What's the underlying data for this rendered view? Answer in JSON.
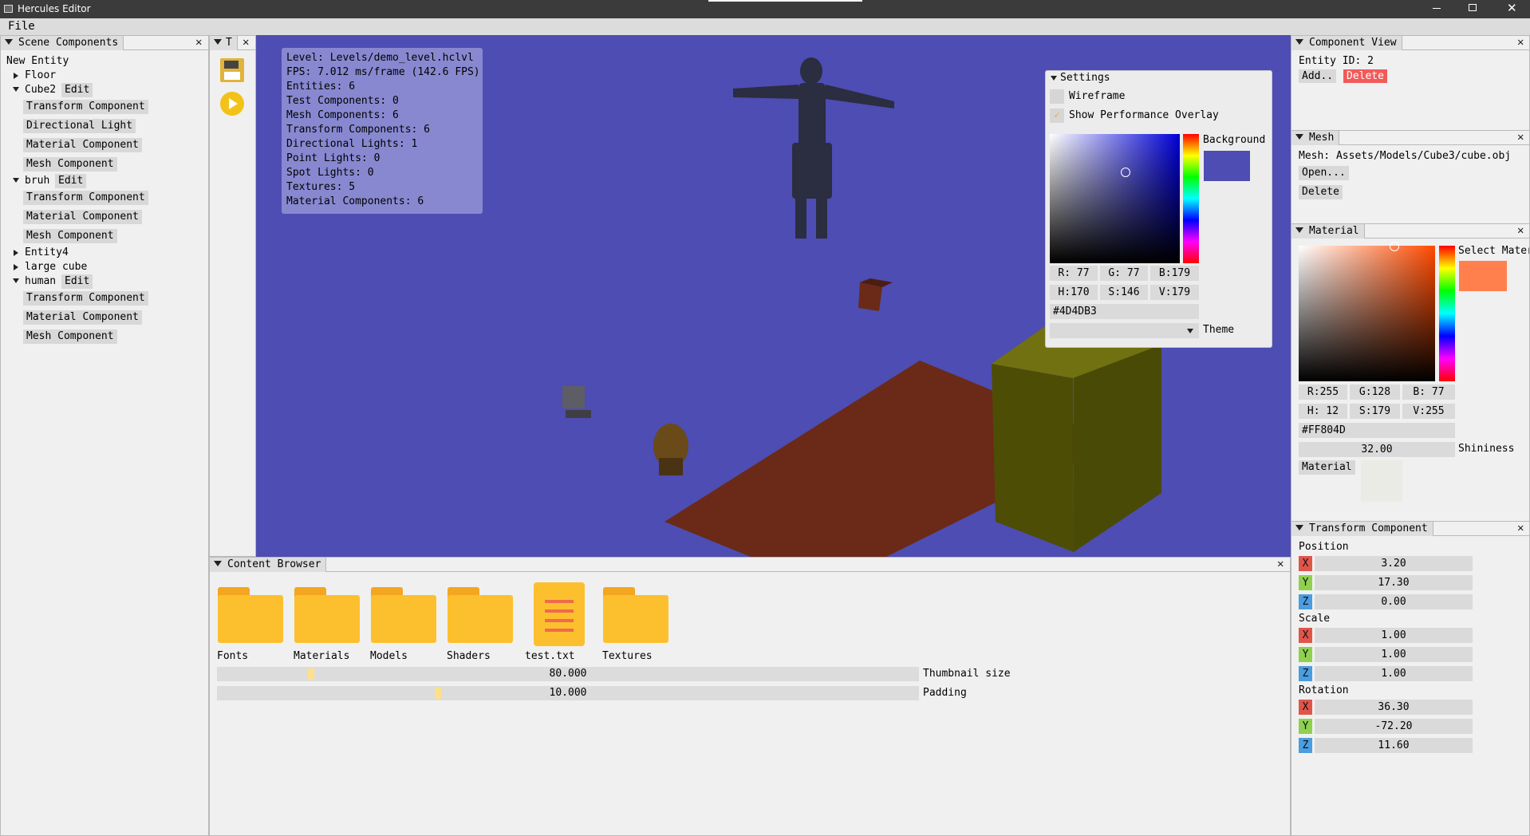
{
  "window": {
    "title": "Hercules Editor",
    "icon": "app-icon"
  },
  "menu": {
    "file": "File"
  },
  "scene": {
    "tab": "Scene Components",
    "new_entity": "New Entity",
    "floor": "Floor",
    "cube2": "Cube2",
    "bruh": "bruh",
    "entity4": "Entity4",
    "large_cube": "large cube",
    "human": "human",
    "edit": "Edit",
    "transform": "Transform Component",
    "dir_light": "Directional Light",
    "material": "Material Component",
    "mesh": "Mesh Component"
  },
  "toolbar": {
    "tab": "T",
    "save_icon": "save-icon",
    "play_icon": "play-icon"
  },
  "overlay": {
    "level": "Level: Levels/demo_level.hclvl",
    "fps": "FPS: 7.012 ms/frame (142.6 FPS)",
    "entities": "Entities: 6",
    "test": "Test Components: 0",
    "mesh": "Mesh Components: 6",
    "transform": "Transform Components: 6",
    "dirlights": "Directional Lights: 1",
    "pointlights": "Point Lights: 0",
    "spotlights": "Spot Lights: 0",
    "textures": "Textures: 5",
    "materials": "Material Components: 6"
  },
  "settings": {
    "title": "Settings",
    "wireframe": "Wireframe",
    "overlay": "Show Performance Overlay",
    "overlay_checked": true,
    "background_label": "Background",
    "background_color": "#4D4DB3",
    "r": "R: 77",
    "g": "G: 77",
    "b": "B:179",
    "h": "H:170",
    "s": "S:146",
    "v": "V:179",
    "hex": "#4D4DB3",
    "theme": "Theme"
  },
  "component_view": {
    "tab": "Component View",
    "entity_id": "Entity ID: 2",
    "add": "Add..",
    "delete": "Delete"
  },
  "mesh": {
    "tab": "Mesh",
    "path": "Mesh: Assets/Models/Cube3/cube.obj",
    "open": "Open...",
    "delete": "Delete"
  },
  "material": {
    "tab": "Material",
    "select": "Select Material",
    "color": "#FF804D",
    "r": "R:255",
    "g": "G:128",
    "b": "B: 77",
    "h": "H: 12",
    "s": "S:179",
    "v": "V:255",
    "hex": "#FF804D",
    "shininess_value": "32.00",
    "shininess": "Shininess",
    "material_label": "Material"
  },
  "transform": {
    "tab": "Transform Component",
    "position": "Position",
    "scale": "Scale",
    "rotation": "Rotation",
    "x": "X",
    "y": "Y",
    "z": "Z",
    "px": "3.20",
    "py": "17.30",
    "pz": "0.00",
    "sx": "1.00",
    "sy": "1.00",
    "sz": "1.00",
    "rx": "36.30",
    "ry": "-72.20",
    "rz": "11.60"
  },
  "content": {
    "tab": "Content Browser",
    "items": [
      "Fonts",
      "Materials",
      "Models",
      "Shaders",
      "test.txt",
      "Textures"
    ],
    "thumb_value": "80.000",
    "thumb_label": "Thumbnail size",
    "pad_value": "10.000",
    "pad_label": "Padding"
  },
  "colors": {
    "viewport_bg": "#4D4DB3",
    "axis_x": "#e0554a",
    "axis_y": "#8fd14f",
    "axis_z": "#4a9de0",
    "delete_btn": "#f25a5a"
  }
}
